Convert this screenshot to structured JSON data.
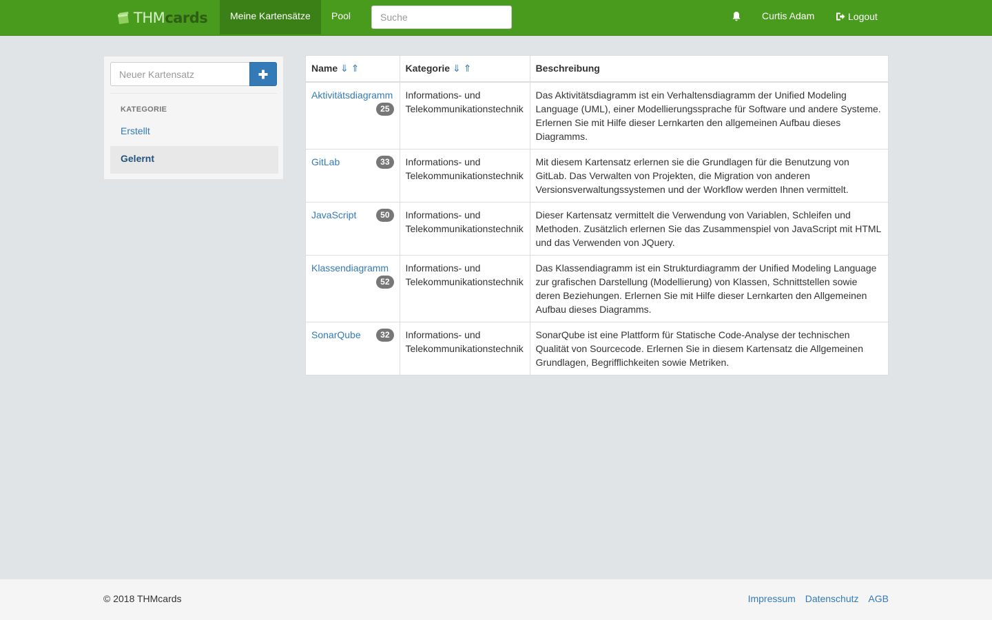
{
  "app": {
    "brand_thm": "THM",
    "brand_cards": "cards",
    "accent_color": "#499b1e"
  },
  "navbar": {
    "items": [
      {
        "label": "Meine Kartensätze",
        "active": true
      },
      {
        "label": "Pool",
        "active": false
      }
    ],
    "search_placeholder": "Suche",
    "bell_icon": "bell-icon",
    "user_name": "Curtis Adam",
    "logout_label": "Logout",
    "logout_icon": "logout-icon"
  },
  "sidebar": {
    "new_set_placeholder": "Neuer Kartensatz",
    "add_icon": "plus-icon",
    "heading": "KATEGORIE",
    "items": [
      {
        "label": "Erstellt",
        "active": false
      },
      {
        "label": "Gelernt",
        "active": true
      }
    ]
  },
  "table": {
    "headers": {
      "name": "Name",
      "category": "Kategorie",
      "description": "Beschreibung",
      "sort_arrows": "⇓ ⇑"
    },
    "rows": [
      {
        "name": "Aktivitätsdiagramm",
        "count": "25",
        "category": "Informations- und Telekommunikationstechnik",
        "description": "Das Aktivitätsdiagramm ist ein Verhaltensdiagramm der Unified Modeling Language (UML), einer Modellierungssprache für Software und andere Systeme. Erlernen Sie mit Hilfe dieser Lernkarten den allgemeinen Aufbau dieses Diagramms."
      },
      {
        "name": "GitLab",
        "count": "33",
        "category": "Informations- und Telekommunikationstechnik",
        "description": "Mit diesem Kartensatz erlernen sie die Grundlagen für die Benutzung von GitLab. Das Verwalten von Projekten, die Migration von anderen Versionsverwaltungssystemen und der Workflow werden Ihnen vermittelt."
      },
      {
        "name": "JavaScript",
        "count": "50",
        "category": "Informations- und Telekommunikationstechnik",
        "description": "Dieser Kartensatz vermittelt die Verwendung von Variablen, Schleifen und Methoden. Zusätzlich erlernen Sie das Zusammenspiel von JavaScript mit HTML und das Verwenden von JQuery."
      },
      {
        "name": "Klassendiagramm",
        "count": "52",
        "category": "Informations- und Telekommunikationstechnik",
        "description": "Das Klassendiagramm ist ein Strukturdiagramm der Unified Modeling Language zur grafischen Darstellung (Modellierung) von Klassen, Schnittstellen sowie deren Beziehungen. Erlernen Sie mit Hilfe dieser Lernkarten den Allgemeinen Aufbau dieses Diagramms."
      },
      {
        "name": "SonarQube",
        "count": "32",
        "category": "Informations- und Telekommunikationstechnik",
        "description": "SonarQube ist eine Plattform für Statische Code-Analyse der technischen Qualität von Sourcecode. Erlernen Sie in diesem Kartensatz die Allgemeinen Grundlagen, Begrifflichkeiten sowie Metriken."
      }
    ]
  },
  "footer": {
    "copyright": "© 2018 THMcards",
    "links": [
      "Impressum",
      "Datenschutz",
      "AGB"
    ]
  }
}
